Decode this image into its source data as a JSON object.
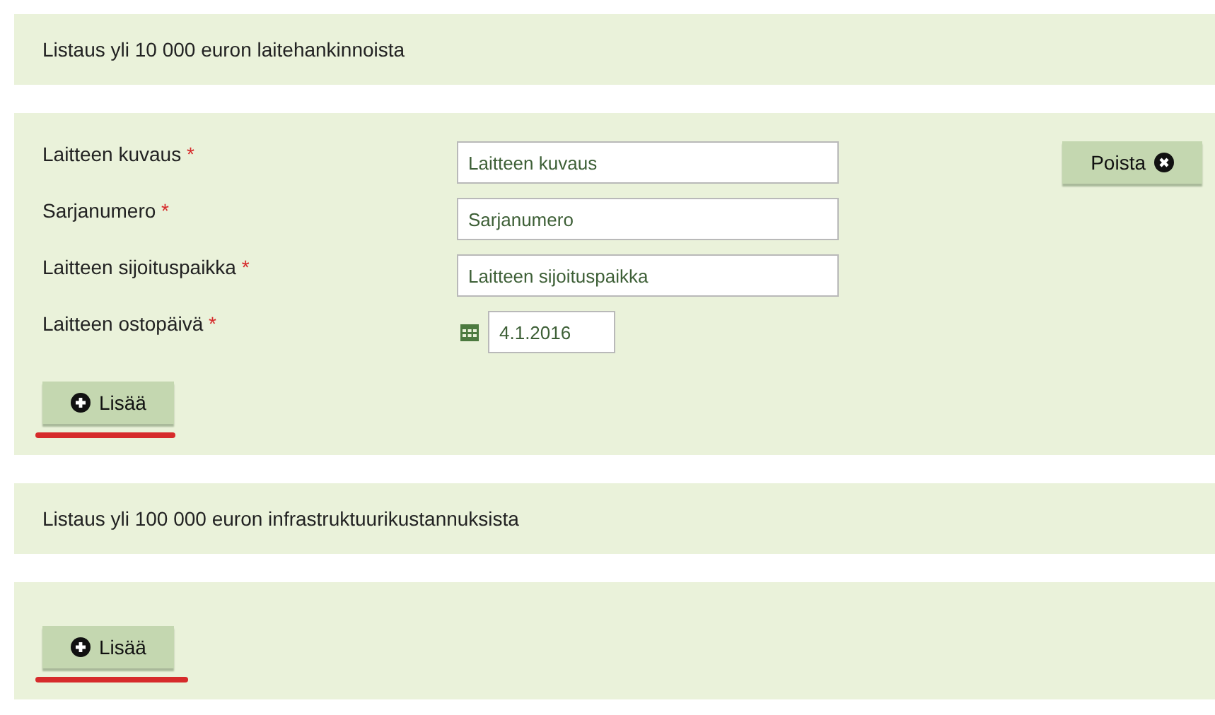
{
  "sections": [
    {
      "kind": "header",
      "title": "Listaus yli 10 000 euron laitehankinnoista"
    },
    {
      "kind": "form",
      "fields": [
        {
          "kind": "text",
          "label": "Laitteen kuvaus",
          "required": "*",
          "placeholder": "Laitteen kuvaus"
        },
        {
          "kind": "text",
          "label": "Sarjanumero",
          "required": "*",
          "placeholder": "Sarjanumero"
        },
        {
          "kind": "text",
          "label": "Laitteen sijoituspaikka",
          "required": "*",
          "placeholder": "Laitteen sijoituspaikka"
        },
        {
          "kind": "date",
          "label": "Laitteen ostopäivä",
          "required": "*",
          "value": "4.1.2016"
        }
      ],
      "remove_button": "Poista",
      "add_button": {
        "label": "Lisää",
        "underlined": true
      }
    },
    {
      "kind": "header",
      "title": "Listaus yli 100 000 euron infrastruktuurikustannuksista"
    },
    {
      "kind": "form",
      "add_button": {
        "label": "Lisää",
        "underlined": true
      }
    }
  ]
}
